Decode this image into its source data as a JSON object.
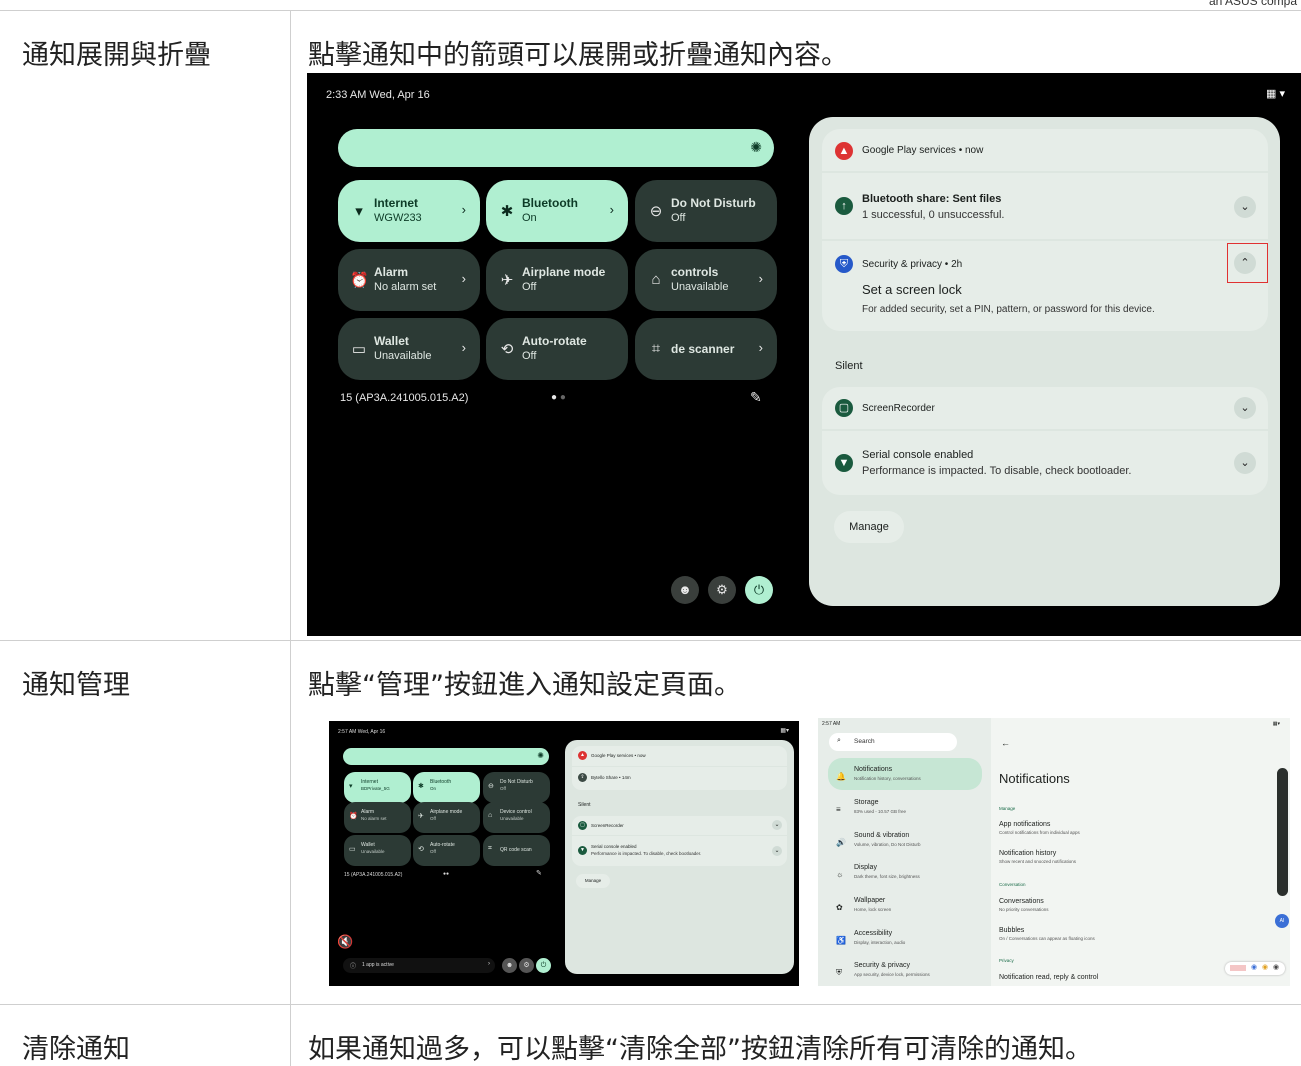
{
  "corner_text": "an ASUS compa",
  "rows": [
    {
      "label": "通知展開與折疊",
      "desc": "點擊通知中的箭頭可以展開或折疊通知內容。"
    },
    {
      "label": "通知管理",
      "desc": "點擊“管理”按鈕進入通知設定頁面。"
    },
    {
      "label": "清除通知",
      "desc": "如果通知過多，可以點擊“清除全部”按鈕清除所有可清除的通知。"
    }
  ],
  "shot1": {
    "status_time": "2:33 AM  Wed, Apr 16",
    "tiles": [
      {
        "title": "Internet",
        "sub": "WGW233",
        "icon": "▾",
        "on": true,
        "chev": true
      },
      {
        "title": "Bluetooth",
        "sub": "On",
        "icon": "✱",
        "on": true,
        "chev": true
      },
      {
        "title": "Do Not Disturb",
        "sub": "Off",
        "icon": "⊖",
        "on": false,
        "chev": false
      },
      {
        "title": "Alarm",
        "sub": "No alarm set",
        "icon": "⏰",
        "on": false,
        "chev": true
      },
      {
        "title": "Airplane mode",
        "sub": "Off",
        "icon": "✈",
        "on": false,
        "chev": false
      },
      {
        "title": " controls",
        "sub": "Unavailable",
        "icon": "⌂",
        "on": false,
        "chev": true
      },
      {
        "title": "Wallet",
        "sub": "Unavailable",
        "icon": "▭",
        "on": false,
        "chev": true
      },
      {
        "title": "Auto-rotate",
        "sub": "Off",
        "icon": "⟲",
        "on": false,
        "chev": false
      },
      {
        "title": "de scanner",
        "sub": "",
        "icon": "⌗",
        "on": false,
        "chev": true
      }
    ],
    "build": "15 (AP3A.241005.015.A2)",
    "notifs": {
      "gps": "Google Play services • now",
      "bt_title": "Bluetooth share: Sent files",
      "bt_sub": "1 successful, 0 unsuccessful.",
      "sec_header": "Security & privacy • 2h",
      "sec_title": "Set a screen lock",
      "sec_sub": "For added security, set a PIN, pattern, or password for this device.",
      "silent": "Silent",
      "rec": "ScreenRecorder",
      "serial_title": "Serial console enabled",
      "serial_sub": "Performance is impacted. To disable, check bootloader.",
      "manage": "Manage"
    }
  },
  "shot2": {
    "status_time": "2:57 AM  Wed, Apr 16",
    "tiles": [
      {
        "title": "Internet",
        "sub": "BDPrivate_5G",
        "icon": "▾",
        "on": true
      },
      {
        "title": "Bluetooth",
        "sub": "On",
        "icon": "✱",
        "on": true
      },
      {
        "title": "Do Not Disturb",
        "sub": "Off",
        "icon": "⊖",
        "on": false
      },
      {
        "title": "Alarm",
        "sub": "No alarm set",
        "icon": "⏰",
        "on": false
      },
      {
        "title": "Airplane mode",
        "sub": "Off",
        "icon": "✈",
        "on": false
      },
      {
        "title": "Device control",
        "sub": "Unavailable",
        "icon": "⌂",
        "on": false
      },
      {
        "title": "Wallet",
        "sub": "Unavailable",
        "icon": "▭",
        "on": false
      },
      {
        "title": "Auto-rotate",
        "sub": "Off",
        "icon": "⟲",
        "on": false
      },
      {
        "title": "QR code scan",
        "sub": "",
        "icon": "⌗",
        "on": false
      }
    ],
    "build": "15 (AP3A.241005.015.A2)",
    "active": "1 app is active",
    "gps": "Google Play services • now",
    "bytello": "Bytello Share • 14m",
    "silent": "Silent",
    "rec": "ScreenRecorder",
    "serial_title": "Serial console enabled",
    "serial_sub": "Performance is impacted. To disable, check bootloader.",
    "manage": "Manage"
  },
  "shot3": {
    "status": "2:57 AM",
    "search": "Search",
    "items": [
      {
        "t": "Notifications",
        "s": "Notification history, conversations",
        "icon": "🔔"
      },
      {
        "t": "Storage",
        "s": "83% used - 10.57 GB free",
        "icon": "≡"
      },
      {
        "t": "Sound & vibration",
        "s": "Volume, vibration, Do Not Disturb",
        "icon": "🔊"
      },
      {
        "t": "Display",
        "s": "Dark theme, font size, brightness",
        "icon": "☼"
      },
      {
        "t": "Wallpaper",
        "s": "Home, lock screen",
        "icon": "✿"
      },
      {
        "t": "Accessibility",
        "s": "Display, interaction, audio",
        "icon": "♿"
      },
      {
        "t": "Security & privacy",
        "s": "App security, device lock, permissions",
        "icon": "⛨"
      }
    ],
    "page_title": "Notifications",
    "sec_manage": "Manage",
    "app_notif": "App notifications",
    "app_notif_s": "Control notifications from individual apps",
    "notif_hist": "Notification history",
    "notif_hist_s": "Show recent and snoozed notifications",
    "sec_conv": "Conversation",
    "conv": "Conversations",
    "conv_s": "No priority conversations",
    "bubbles": "Bubbles",
    "bubbles_s": "On / Conversations can appear as floating icons",
    "sec_priv": "Privacy",
    "read_reply": "Notification read, reply & control"
  }
}
